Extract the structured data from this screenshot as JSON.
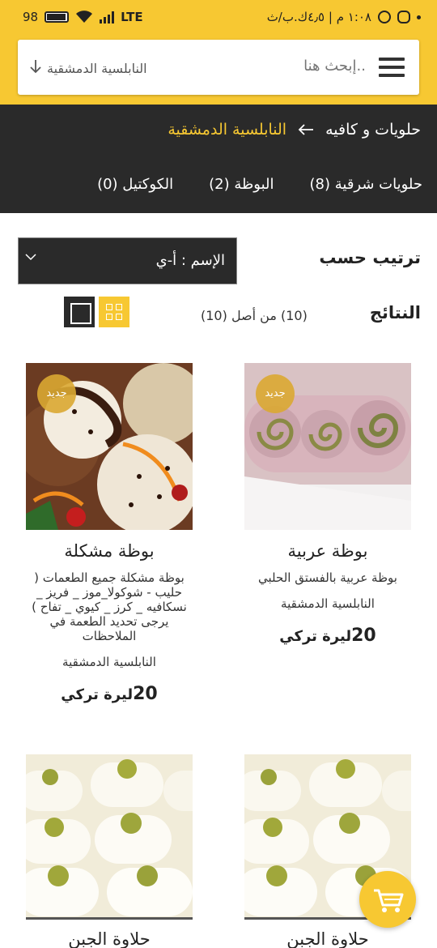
{
  "status_bar": {
    "time": "١:٠٨ م | ٤٫٥ك.ب/ث",
    "network": "LTE",
    "battery": "98"
  },
  "search": {
    "placeholder": "إبحث هنا..",
    "scope": "النابلسية الدمشقية"
  },
  "breadcrumb": {
    "parent": "حلويات و كافيه",
    "current": "النابلسية الدمشقية"
  },
  "tabs": [
    {
      "label": "حلويات شرقية (8)"
    },
    {
      "label": "البوظة (2)"
    },
    {
      "label": "الكوكتيل (0)"
    }
  ],
  "sort": {
    "label": "ترتيب حسب",
    "value": "الإسم : أ-ي"
  },
  "results": {
    "label": "النتائج",
    "count": "(10) من أصل (10)"
  },
  "products": [
    {
      "badge": "جديد",
      "name": "بوظة عربية",
      "description": "بوظة عربية بالفستق الحلبي",
      "vendor": "النابلسية الدمشقية",
      "price_num": "20",
      "price_currency": "ليرة تركي"
    },
    {
      "badge": "جديد",
      "name": "بوظة مشكلة",
      "description": "بوظة مشكلة جميع الطعمات ( حليب - شوكولا_موز _ فريز _ نسكافيه _ كرز _ كيوي _ تفاح ) يرجى تحديد الطعمة في الملاحظات",
      "vendor": "النابلسية الدمشقية",
      "price_num": "20",
      "price_currency": "ليرة تركي"
    },
    {
      "name": "حلاوة الجبن"
    },
    {
      "name": "حلاوة الجبن"
    }
  ],
  "colors": {
    "accent": "#f7c832",
    "dark": "#2a2a2a"
  }
}
